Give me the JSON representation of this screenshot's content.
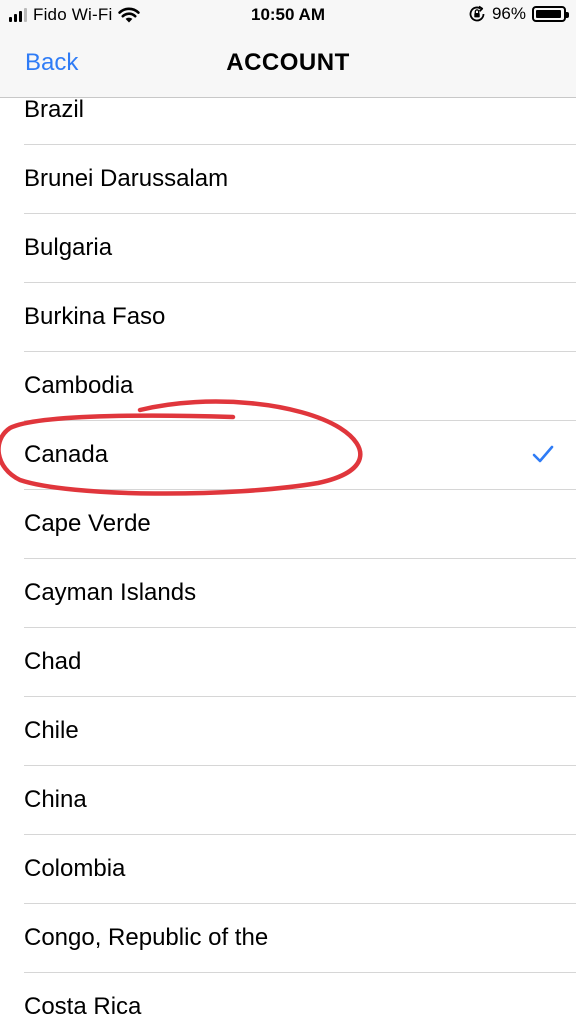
{
  "status_bar": {
    "carrier": "Fido Wi-Fi",
    "time": "10:50 AM",
    "battery_percent": "96%",
    "battery_level": 0.96,
    "signal_bars_filled": 3,
    "signal_bars_total": 4
  },
  "nav": {
    "back_label": "Back",
    "title": "ACCOUNT"
  },
  "countries": [
    {
      "name": "Brazil",
      "selected": false
    },
    {
      "name": "Brunei Darussalam",
      "selected": false
    },
    {
      "name": "Bulgaria",
      "selected": false
    },
    {
      "name": "Burkina Faso",
      "selected": false
    },
    {
      "name": "Cambodia",
      "selected": false
    },
    {
      "name": "Canada",
      "selected": true
    },
    {
      "name": "Cape Verde",
      "selected": false
    },
    {
      "name": "Cayman Islands",
      "selected": false
    },
    {
      "name": "Chad",
      "selected": false
    },
    {
      "name": "Chile",
      "selected": false
    },
    {
      "name": "China",
      "selected": false
    },
    {
      "name": "Colombia",
      "selected": false
    },
    {
      "name": "Congo, Republic of the",
      "selected": false
    },
    {
      "name": "Costa Rica",
      "selected": false
    }
  ],
  "colors": {
    "accent": "#2f7cf6",
    "annotation": "#e0363c",
    "separator": "#d6d6d6",
    "bar_background": "#f7f7f7"
  },
  "icons": {
    "signal": "cellular-signal-icon",
    "wifi": "wifi-icon",
    "rotation_lock": "rotation-lock-icon",
    "battery": "battery-icon",
    "checkmark": "checkmark-icon"
  }
}
